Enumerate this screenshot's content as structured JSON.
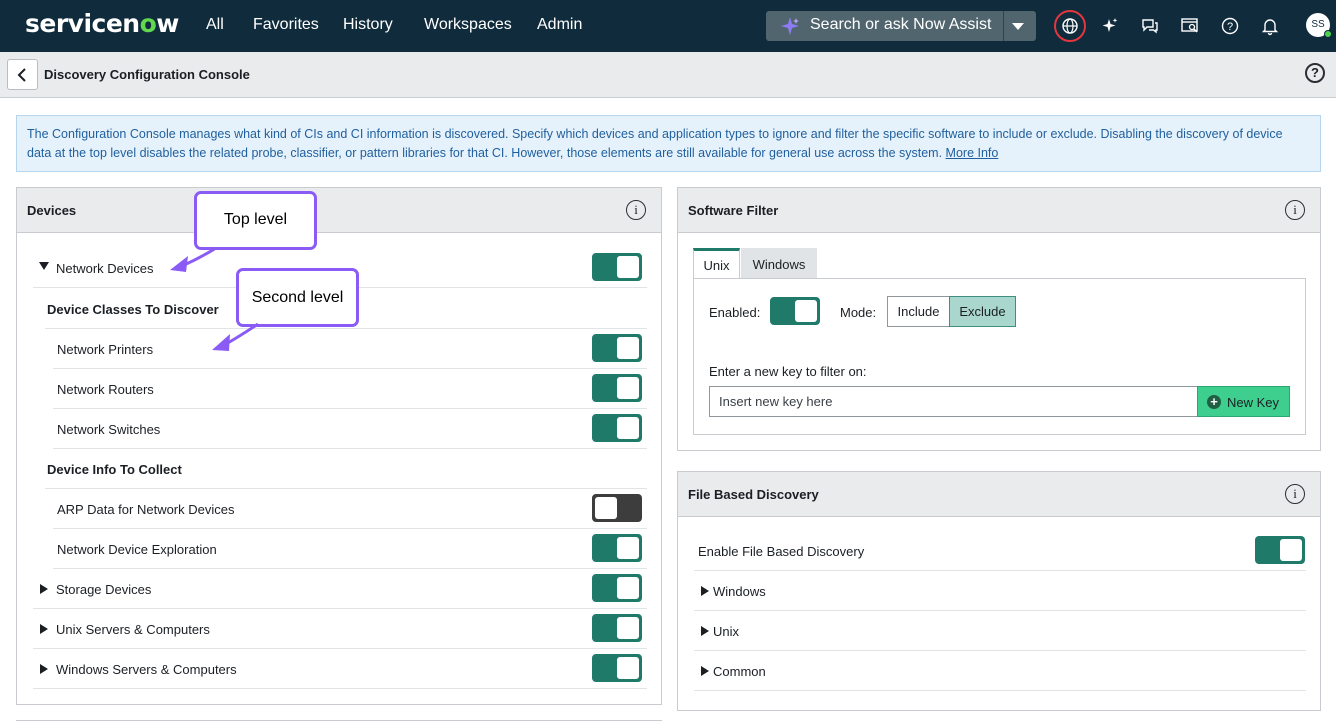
{
  "nav": {
    "logo_a": "servicen",
    "logo_o": "o",
    "logo_b": "w",
    "links": [
      "All",
      "Favorites",
      "History",
      "Workspaces",
      "Admin"
    ],
    "search_text": "Search or ask Now Assist",
    "avatar_initials": "SS"
  },
  "header": {
    "title": "Discovery Configuration Console",
    "help": "?"
  },
  "banner": {
    "text": "The Configuration Console manages what kind of CIs and CI information is discovered. Specify which devices and application types to ignore and filter the specific software to include or exclude. Disabling the discovery of device data at the top level disables the related probe, classifier, or pattern libraries for that CI. However, those elements are still available for general use across the system.",
    "link": "More Info"
  },
  "devices": {
    "title": "Devices",
    "network_devices": {
      "label": "Network Devices",
      "enabled": true
    },
    "classes_heading": "Device Classes To Discover",
    "classes": [
      {
        "label": "Network Printers",
        "enabled": true
      },
      {
        "label": "Network Routers",
        "enabled": true
      },
      {
        "label": "Network Switches",
        "enabled": true
      }
    ],
    "info_heading": "Device Info To Collect",
    "info": [
      {
        "label": "ARP Data for Network Devices",
        "enabled": false
      },
      {
        "label": "Network Device Exploration",
        "enabled": true
      }
    ],
    "others": [
      {
        "label": "Storage Devices",
        "enabled": true
      },
      {
        "label": "Unix Servers & Computers",
        "enabled": true
      },
      {
        "label": "Windows Servers & Computers",
        "enabled": true
      }
    ]
  },
  "callouts": {
    "top_level": "Top level",
    "second_level": "Second level"
  },
  "software_filter": {
    "title": "Software Filter",
    "tabs": [
      "Unix",
      "Windows"
    ],
    "active_tab": "Unix",
    "enabled_label": "Enabled:",
    "enabled": true,
    "mode_label": "Mode:",
    "modes": [
      "Include",
      "Exclude"
    ],
    "selected_mode": "Exclude",
    "key_label": "Enter a new key to filter on:",
    "key_placeholder": "Insert new key here",
    "new_key_label": "New Key"
  },
  "file_discovery": {
    "title": "File Based Discovery",
    "enable_label": "Enable File Based Discovery",
    "enabled": true,
    "sections": [
      "Windows",
      "Unix",
      "Common"
    ]
  },
  "colors": {
    "nav_bg": "#0f2b3c",
    "toggle_on": "#1f7a6a",
    "toggle_off": "#3d3d3d",
    "callout_border": "#8a5cf5",
    "new_key_bg": "#3ecf8e"
  }
}
